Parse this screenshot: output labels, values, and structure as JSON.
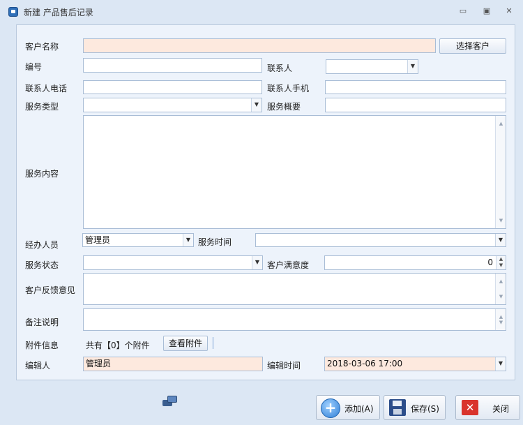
{
  "window": {
    "title": "新建 产品售后记录",
    "minimize": "▭",
    "maximize": "▣",
    "close": "✕"
  },
  "form": {
    "customer_name": {
      "label": "客户名称",
      "value": ""
    },
    "select_customer_button": "选择客户",
    "code": {
      "label": "编号",
      "value": ""
    },
    "contact": {
      "label": "联系人",
      "value": ""
    },
    "contact_phone": {
      "label": "联系人电话",
      "value": ""
    },
    "contact_mobile": {
      "label": "联系人手机",
      "value": ""
    },
    "service_type": {
      "label": "服务类型",
      "value": ""
    },
    "service_summary": {
      "label": "服务概要",
      "value": ""
    },
    "service_content": {
      "label": "服务内容",
      "value": ""
    },
    "handler": {
      "label": "经办人员",
      "value": "管理员"
    },
    "service_time": {
      "label": "服务时间",
      "value": ""
    },
    "service_status": {
      "label": "服务状态",
      "value": ""
    },
    "satisfaction": {
      "label": "客户满意度",
      "value": "0"
    },
    "feedback": {
      "label": "客户反馈意见",
      "value": ""
    },
    "remarks": {
      "label": "备注说明",
      "value": ""
    },
    "attachment": {
      "label": "附件信息",
      "text": "共有【0】个附件",
      "view_button": "查看附件"
    },
    "editor": {
      "label": "编辑人",
      "value": "管理员"
    },
    "edit_time": {
      "label": "编辑时间",
      "value": "2018-03-06 17:00"
    }
  },
  "footer": {
    "add_button": "添加(A)",
    "save_button": "保存(S)",
    "close_button": "关闭"
  },
  "icons": {
    "app": "app-icon",
    "dropdown": "▼",
    "spin_up": "▲",
    "spin_down": "▼"
  },
  "colors": {
    "required_field_bg": "#fde9de",
    "window_bg": "#dce7f4",
    "panel_bg": "#edf3fb"
  }
}
